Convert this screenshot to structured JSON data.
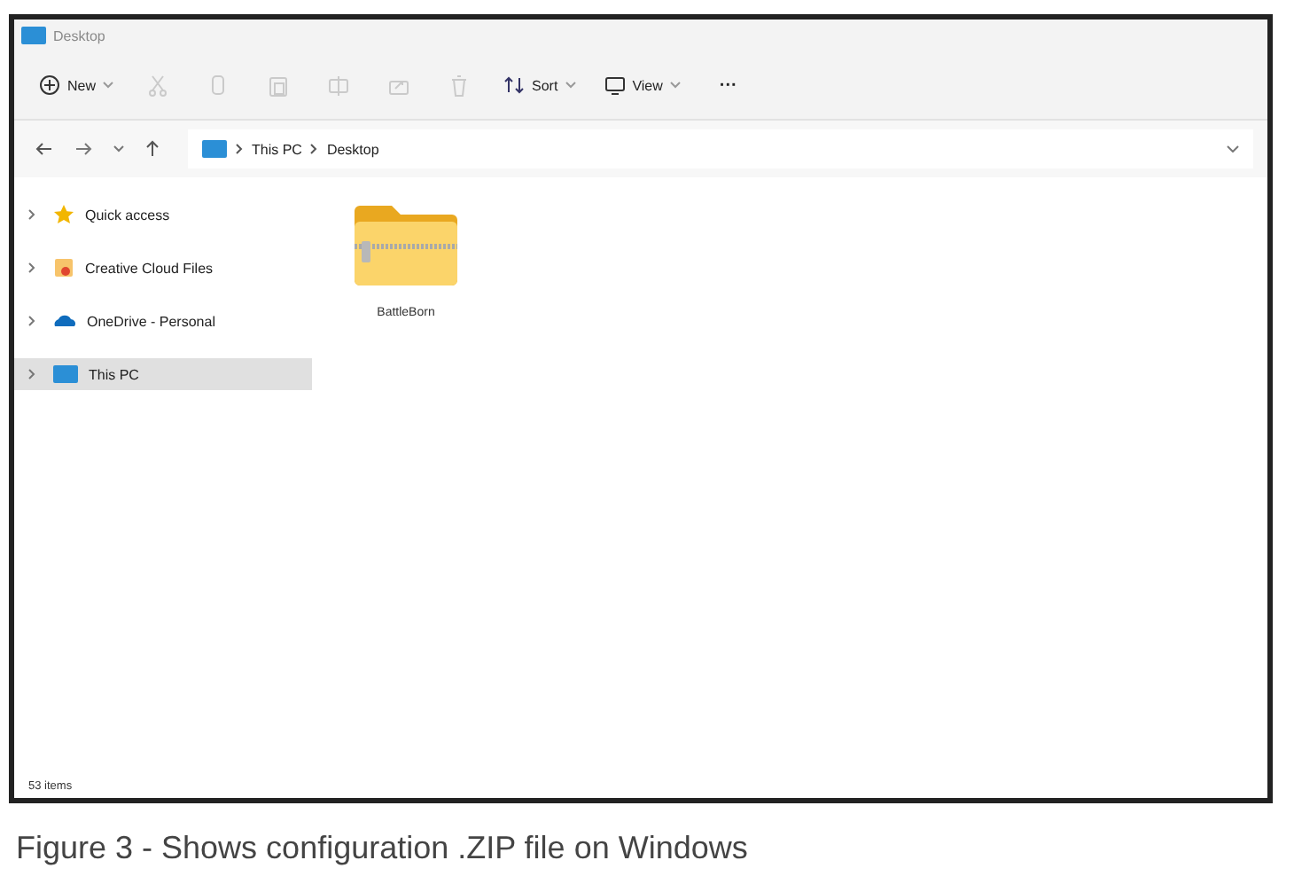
{
  "window": {
    "title": "Desktop"
  },
  "toolbar": [
    {
      "kind": "new",
      "label": "New",
      "disabled": false
    },
    {
      "kind": "cut",
      "disabled": true
    },
    {
      "kind": "copy",
      "disabled": true
    },
    {
      "kind": "paste",
      "disabled": true
    },
    {
      "kind": "rename",
      "disabled": true
    },
    {
      "kind": "share",
      "disabled": true
    },
    {
      "kind": "delete",
      "disabled": true
    },
    {
      "kind": "sort",
      "label": "Sort",
      "disabled": false
    },
    {
      "kind": "view",
      "label": "View",
      "disabled": false
    },
    {
      "kind": "more",
      "label": "···",
      "disabled": false
    }
  ],
  "address": {
    "crumbs": [
      "This PC",
      "Desktop"
    ]
  },
  "sidebar": {
    "items": [
      {
        "label": "Quick access",
        "selected": false,
        "expanded": false
      },
      {
        "label": "Creative Cloud Files",
        "selected": false,
        "expanded": false
      },
      {
        "label": "OneDrive - Personal",
        "selected": false,
        "expanded": false
      },
      {
        "label": "This PC",
        "selected": true,
        "expanded": false
      }
    ]
  },
  "files": [
    {
      "name": "BattleBorn",
      "selected": false
    }
  ],
  "status_bar": "53 items",
  "caption": "Figure 3 - Shows configuration .ZIP file on Windows"
}
